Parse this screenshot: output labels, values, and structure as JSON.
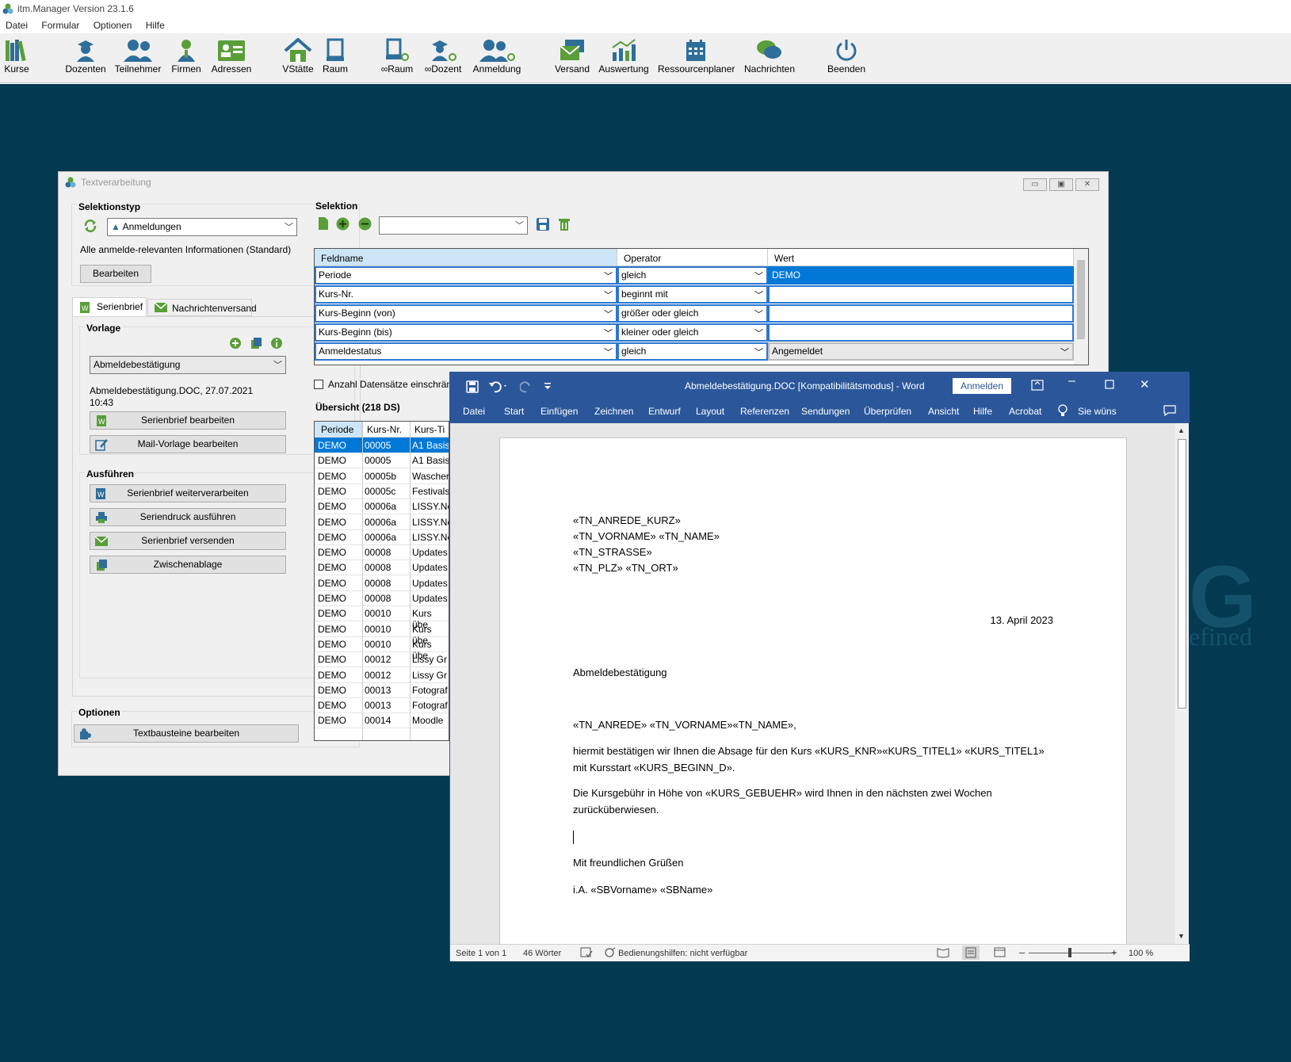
{
  "app": {
    "title": "itm.Manager Version 23.1.6",
    "menu": [
      "Datei",
      "Formular",
      "Optionen",
      "Hilfe"
    ],
    "toolbar": [
      {
        "label": "Kurse",
        "icon": "books-icon"
      },
      {
        "label": "Dozenten",
        "icon": "lecturer-icon"
      },
      {
        "label": "Teilnehmer",
        "icon": "participants-icon"
      },
      {
        "label": "Firmen",
        "icon": "company-person-icon"
      },
      {
        "label": "Adressen",
        "icon": "address-card-icon"
      },
      {
        "label": "VStätte",
        "icon": "house-icon"
      },
      {
        "label": "Raum",
        "icon": "door-icon"
      },
      {
        "label": "∞Raum",
        "icon": "room-link-icon"
      },
      {
        "label": "∞Dozent",
        "icon": "lecturer-link-icon"
      },
      {
        "label": "Anmeldung",
        "icon": "registration-icon"
      },
      {
        "label": "Versand",
        "icon": "mail-stack-icon"
      },
      {
        "label": "Auswertung",
        "icon": "chart-icon"
      },
      {
        "label": "Ressourcenplaner",
        "icon": "calendar-icon"
      },
      {
        "label": "Nachrichten",
        "icon": "chat-icon"
      },
      {
        "label": "Beenden",
        "icon": "power-icon"
      }
    ],
    "colors": {
      "desktop": "#033a52",
      "accent_green": "#5a9e3a",
      "toolbar_blue": "#2f6e9a",
      "word_blue": "#2b579a",
      "select_blue": "#0078d7"
    }
  },
  "textverarbeitung": {
    "title": "Textverarbeitung",
    "selektionstyp": {
      "heading": "Selektionstyp",
      "selected": "Anmeldungen",
      "description": "Alle anmelde-relevanten Informationen (Standard)",
      "edit_button": "Bearbeiten"
    },
    "tabs": [
      "Serienbrief",
      "Nachrichtenversand"
    ],
    "vorlage": {
      "heading": "Vorlage",
      "selected": "Abmeldebestätigung",
      "file_info": "Abmeldebestätigung.DOC, 27.07.2021",
      "file_time": "10:43",
      "buttons": [
        "Serienbrief bearbeiten",
        "Mail-Vorlage bearbeiten"
      ]
    },
    "ausfuehren": {
      "heading": "Ausführen",
      "buttons": [
        "Serienbrief weiterverarbeiten",
        "Seriendruck ausführen",
        "Serienbrief versenden",
        "Zwischenablage"
      ]
    },
    "optionen": {
      "heading": "Optionen",
      "button": "Textbausteine bearbeiten"
    },
    "selektion": {
      "heading": "Selektion",
      "columns": [
        "Feldname",
        "Operator",
        "Wert"
      ],
      "rows": [
        {
          "field": "Periode",
          "op": "gleich",
          "value": "DEMO"
        },
        {
          "field": "Kurs-Nr.",
          "op": "beginnt mit",
          "value": ""
        },
        {
          "field": "Kurs-Beginn (von)",
          "op": "größer oder gleich",
          "value": ""
        },
        {
          "field": "Kurs-Beginn (bis)",
          "op": "kleiner oder gleich",
          "value": ""
        },
        {
          "field": "Anmeldestatus",
          "op": "gleich",
          "value": "Angemeldet"
        }
      ],
      "limit_checkbox": "Anzahl Datensätze einschränk"
    },
    "uebersicht": {
      "heading": "Übersicht (218 DS)",
      "columns": [
        "Periode",
        "Kurs-Nr.",
        "Kurs-Ti"
      ],
      "rows": [
        [
          "DEMO",
          "00005",
          "A1 Basis"
        ],
        [
          "DEMO",
          "00005",
          "A1 Basis"
        ],
        [
          "DEMO",
          "00005b",
          "Wascher"
        ],
        [
          "DEMO",
          "00005c",
          "Festivals"
        ],
        [
          "DEMO",
          "00006a",
          "LISSY.Ne"
        ],
        [
          "DEMO",
          "00006a",
          "LISSY.Ne"
        ],
        [
          "DEMO",
          "00006a",
          "LISSY.Ne"
        ],
        [
          "DEMO",
          "00008",
          "Updates"
        ],
        [
          "DEMO",
          "00008",
          "Updates"
        ],
        [
          "DEMO",
          "00008",
          "Updates"
        ],
        [
          "DEMO",
          "00008",
          "Updates"
        ],
        [
          "DEMO",
          "00010",
          "Kurs übe"
        ],
        [
          "DEMO",
          "00010",
          "Kurs übe"
        ],
        [
          "DEMO",
          "00010",
          "Kurs übe"
        ],
        [
          "DEMO",
          "00012",
          "Lissy Gr"
        ],
        [
          "DEMO",
          "00012",
          "Lissy Gr"
        ],
        [
          "DEMO",
          "00013",
          "Fotograf"
        ],
        [
          "DEMO",
          "00013",
          "Fotograf"
        ],
        [
          "DEMO",
          "00014",
          "Moodle"
        ]
      ]
    }
  },
  "word": {
    "title": "Abmeldebestätigung.DOC [Kompatibilitätsmodus]  -  Word",
    "signin": "Anmelden",
    "ribbon": [
      "Datei",
      "Start",
      "Einfügen",
      "Zeichnen",
      "Entwurf",
      "Layout",
      "Referenzen",
      "Sendungen",
      "Überprüfen",
      "Ansicht",
      "Hilfe",
      "Acrobat"
    ],
    "tell_me": "Sie wüns",
    "doc": {
      "addr1": "«TN_ANREDE_KURZ»",
      "addr2": "«TN_VORNAME» «TN_NAME»",
      "addr3": "«TN_STRASSE»",
      "addr4": "«TN_PLZ» «TN_ORT»",
      "date": "13. April 2023",
      "subject": "Abmeldebestätigung",
      "salutation": "«TN_ANREDE» «TN_VORNAME»«TN_NAME»,",
      "p1a": "hiermit bestätigen wir Ihnen die Absage für den Kurs «KURS_KNR»«KURS_TITEL1» «KURS_TITEL1»",
      "p1b": "mit Kursstart «KURS_BEGINN_D».",
      "p2a": "Die Kursgebühr in Höhe von «KURS_GEBUEHR» wird Ihnen in den nächsten zwei Wochen",
      "p2b": "zurücküberwiesen.",
      "closing": "Mit freundlichen Grüßen",
      "sign": "i.A. «SBVorname» «SBName»"
    },
    "status": {
      "page": "Seite 1 von 1",
      "words": "46 Wörter",
      "accessibility": "Bedienungshilfen: nicht verfügbar",
      "zoom": "100 %"
    }
  },
  "watermark": {
    "letter": "G",
    "text": "efined"
  }
}
